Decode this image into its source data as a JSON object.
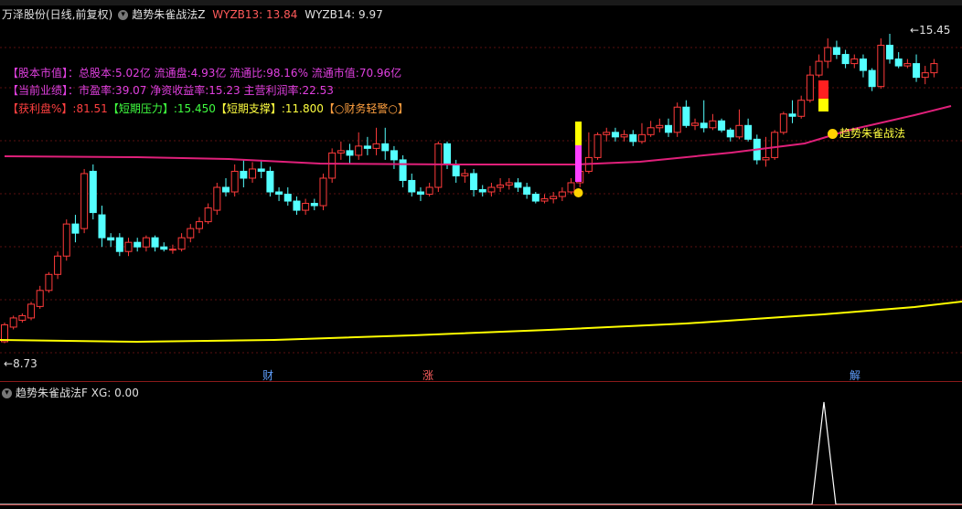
{
  "header": {
    "stock_name": "万泽股份(日线,前复权)",
    "indicator_name": "趋势朱雀战法Z",
    "wyzb13": "WYZB13: 13.84",
    "wyzb14": "WYZB14: 9.97"
  },
  "info": {
    "row1_label": "【股本市值】：",
    "row1_text": "总股本:5.02亿 流通盘:4.93亿 流通比:98.16% 流通市值:70.96亿",
    "row2_label": "【当前业绩】：",
    "row2_text": "市盈率:39.07 净资收益率:15.23 主营利润率:22.53",
    "row3_a": "【获利盘%】:81.51",
    "row3_b": "【短期压力】:15.450",
    "row3_c": "【短期支撑】:11.800",
    "row3_d": "【○财务轻警○】"
  },
  "labels": {
    "high_price": "15.45",
    "low_price": "8.73",
    "signal_label": "趋势朱雀战法",
    "mark_cai": "财",
    "mark_zhang": "涨",
    "mark_jie": "解"
  },
  "sub": {
    "name": "趋势朱雀战法F",
    "xg": "XG: 0.00"
  },
  "colors": {
    "up": "#ff3b3b",
    "down": "#54ffff",
    "ma_long": "#ffff00",
    "ma_mid": "#e0207a",
    "signal": "#ff40ff"
  }
}
